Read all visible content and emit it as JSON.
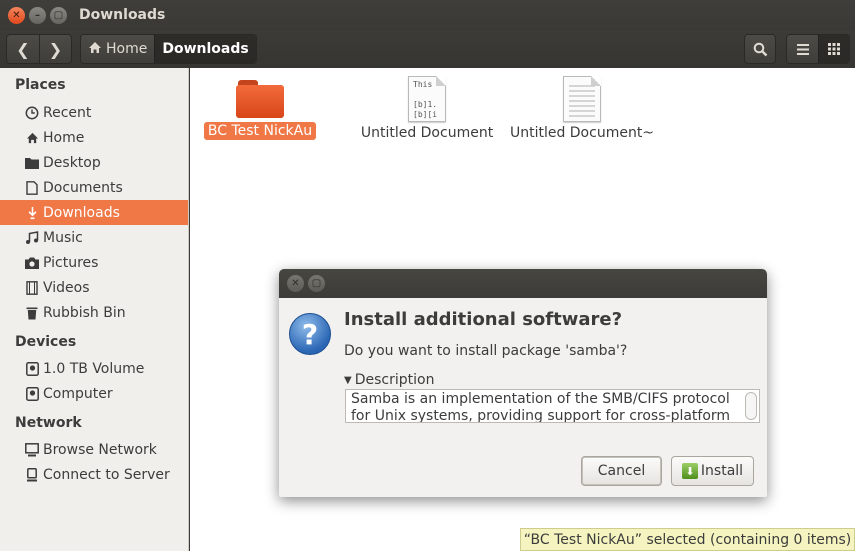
{
  "window": {
    "title": "Downloads"
  },
  "toolbar": {
    "back_glyph": "❮",
    "forward_glyph": "❯",
    "breadcrumbs": [
      {
        "label": "Home",
        "icon": "home-icon"
      },
      {
        "label": "Downloads"
      }
    ],
    "search_icon": "search-icon",
    "list_view_icon": "list-view-icon",
    "grid_view_icon": "grid-view-icon"
  },
  "sidebar": {
    "places_label": "Places",
    "places": [
      {
        "label": "Recent",
        "icon": "clock-icon",
        "glyph": "🕓"
      },
      {
        "label": "Home",
        "icon": "home-icon",
        "glyph": "⌂"
      },
      {
        "label": "Desktop",
        "icon": "folder-icon",
        "glyph": "▆"
      },
      {
        "label": "Documents",
        "icon": "document-icon",
        "glyph": "▯"
      },
      {
        "label": "Downloads",
        "icon": "download-icon",
        "glyph": "⇣"
      },
      {
        "label": "Music",
        "icon": "music-icon",
        "glyph": "♫"
      },
      {
        "label": "Pictures",
        "icon": "camera-icon",
        "glyph": "◙"
      },
      {
        "label": "Videos",
        "icon": "film-icon",
        "glyph": "▤"
      },
      {
        "label": "Rubbish Bin",
        "icon": "trash-icon",
        "glyph": "▥"
      }
    ],
    "devices_label": "Devices",
    "devices": [
      {
        "label": "1.0 TB Volume",
        "icon": "drive-icon",
        "glyph": "◘"
      },
      {
        "label": "Computer",
        "icon": "drive-icon",
        "glyph": "◘"
      }
    ],
    "network_label": "Network",
    "network": [
      {
        "label": "Browse Network",
        "icon": "network-icon",
        "glyph": "▣"
      },
      {
        "label": "Connect to Server",
        "icon": "server-icon",
        "glyph": "▯"
      }
    ],
    "selected": "Downloads"
  },
  "files": [
    {
      "name": "BC Test NickAu",
      "type": "folder",
      "selected": true
    },
    {
      "name": "Untitled Document",
      "type": "text",
      "preview": "This\n\n[b]1.\n[b][i"
    },
    {
      "name": "Untitled Document~",
      "type": "text-blank"
    }
  ],
  "dialog": {
    "heading": "Install additional software?",
    "message": "Do you want to install package 'samba'?",
    "expander_label": "Description",
    "description": "Samba is an implementation of the SMB/CIFS protocol for Unix systems, providing support for cross-platform",
    "cancel_label": "Cancel",
    "install_label": "Install",
    "question_glyph": "?"
  },
  "status": {
    "text": "“BC Test NickAu” selected  (containing 0 items)"
  }
}
